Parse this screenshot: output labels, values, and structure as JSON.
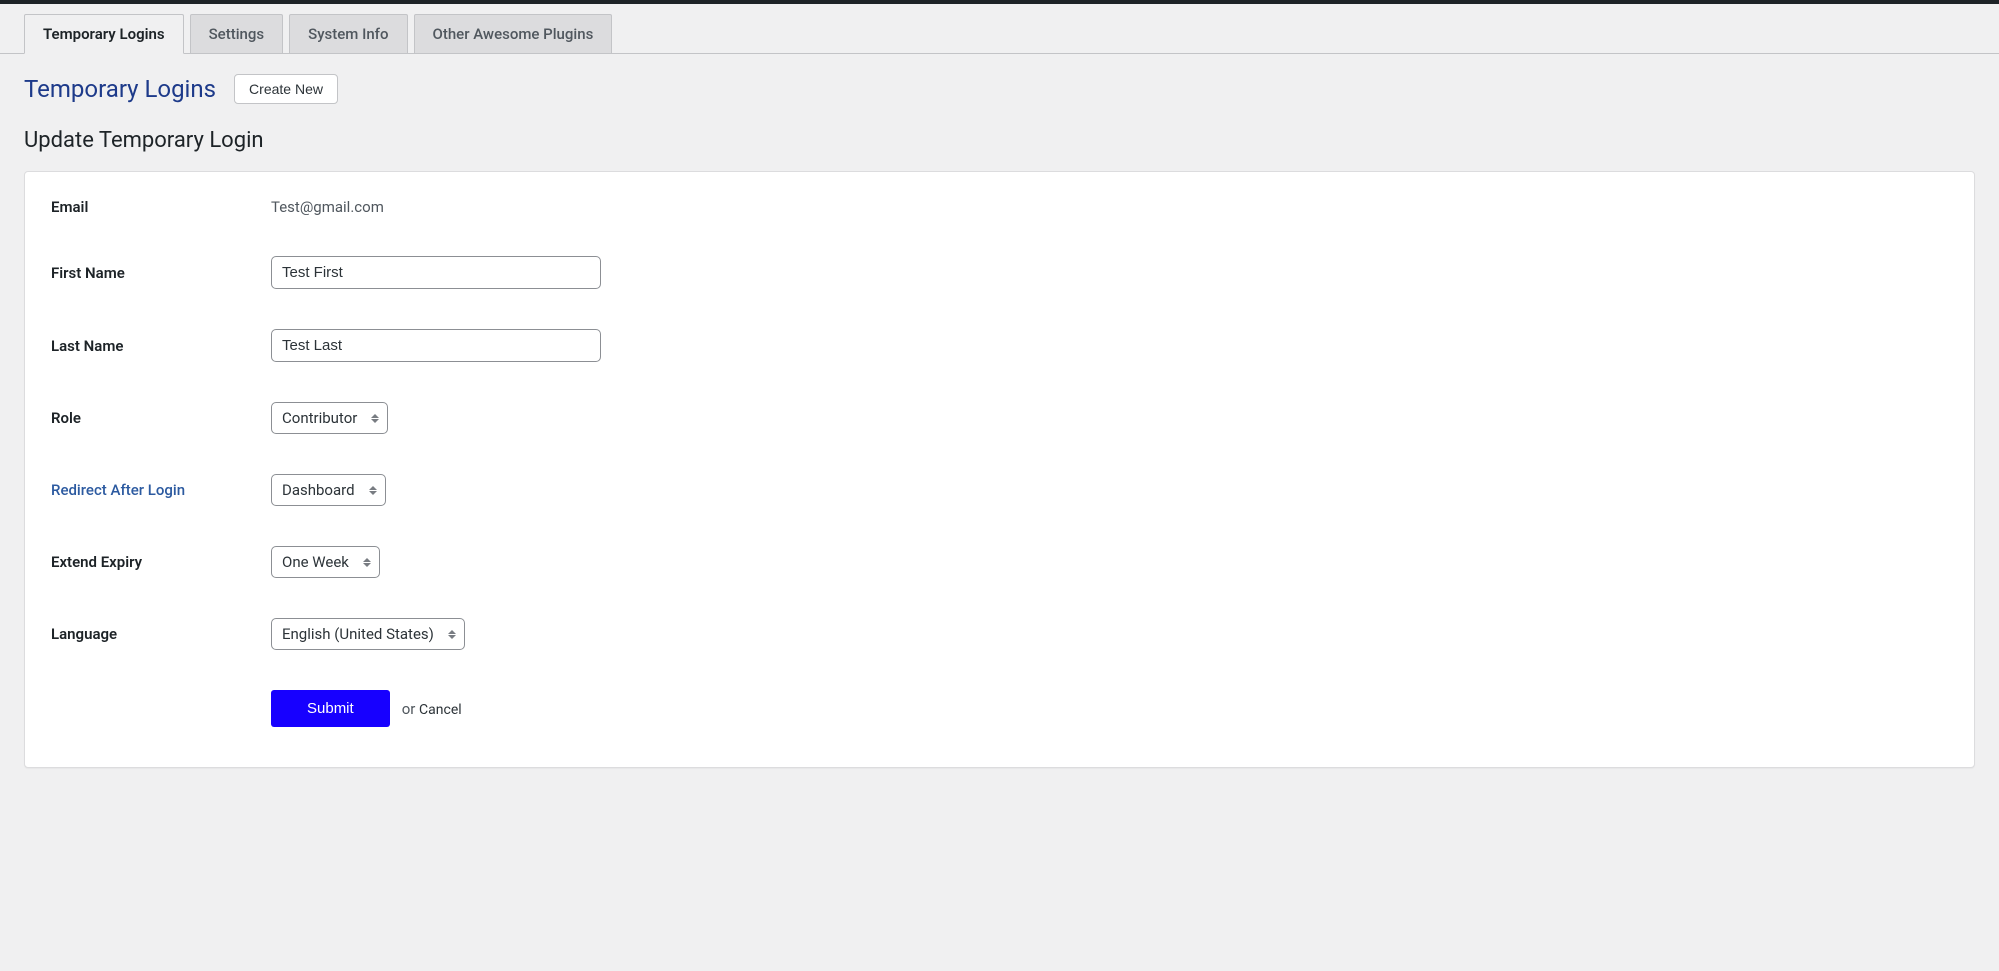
{
  "tabs": {
    "temporary_logins": "Temporary Logins",
    "settings": "Settings",
    "system_info": "System Info",
    "other_plugins": "Other Awesome Plugins"
  },
  "header": {
    "page_title": "Temporary Logins",
    "create_button": "Create New",
    "subtitle": "Update Temporary Login"
  },
  "form": {
    "email": {
      "label": "Email",
      "value": "Test@gmail.com"
    },
    "first_name": {
      "label": "First Name",
      "value": "Test First"
    },
    "last_name": {
      "label": "Last Name",
      "value": "Test Last"
    },
    "role": {
      "label": "Role",
      "value": "Contributor"
    },
    "redirect": {
      "label": "Redirect After Login",
      "value": "Dashboard"
    },
    "expiry": {
      "label": "Extend Expiry",
      "value": "One Week"
    },
    "language": {
      "label": "Language",
      "value": "English (United States)"
    },
    "submit": "Submit",
    "or": "or ",
    "cancel": "Cancel"
  }
}
